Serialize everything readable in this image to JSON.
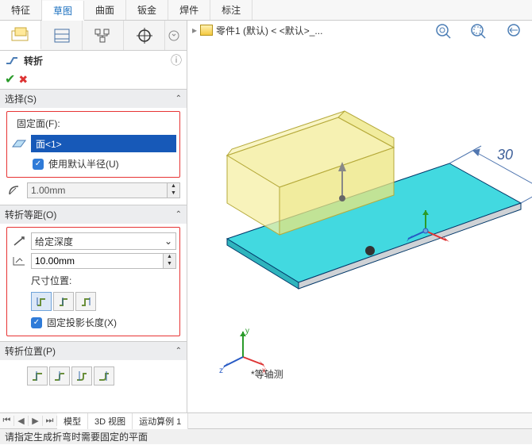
{
  "top_tabs": [
    "特征",
    "草图",
    "曲面",
    "钣金",
    "焊件",
    "标注"
  ],
  "active_top_tab": 1,
  "breadcrumb": "零件1 (默认) < <默认>_...",
  "feature_title": "转折",
  "sections": {
    "selection": {
      "title": "选择(S)",
      "fixed_face_label": "固定面(F):",
      "face_value": "面<1>",
      "use_default_radius": "使用默认半径(U)",
      "radius_value": "1.00mm"
    },
    "offset": {
      "title": "转折等距(O)",
      "depth_type": "给定深度",
      "distance": "10.00mm",
      "dim_pos_label": "尺寸位置:",
      "fix_proj": "固定投影长度(X)"
    },
    "position": {
      "title": "转折位置(P)"
    }
  },
  "dimension_text": "30",
  "view_label": "*等轴测",
  "bottom_tabs": [
    "模型",
    "3D 视图",
    "运动算例 1"
  ],
  "status_text": "请指定生成折弯时需要固定的平面"
}
